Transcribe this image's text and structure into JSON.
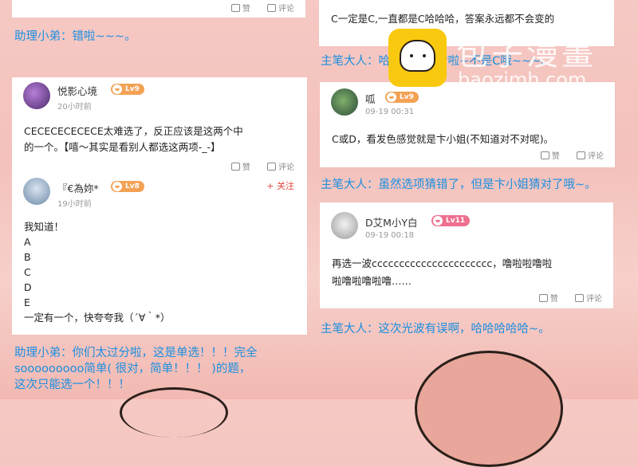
{
  "left": {
    "top_card_actions": {
      "like": "赞",
      "comment": "评论"
    },
    "caption1": "助理小弟：错啦~~~。",
    "comment1": {
      "username": "悦影心境",
      "level": "Lv9",
      "time": "20小时前",
      "text_line1": "CECECECECECE太难选了，反正应该是这两个中",
      "text_line2": "的一个。【嘻～其实是看别人都选这两项-_-】",
      "like": "赞",
      "comment": "评论"
    },
    "comment2": {
      "username": "『€為妳*",
      "level": "Lv8",
      "time": "19小时前",
      "follow": "+ 关注",
      "lines": [
        "我知道！",
        "A",
        "B",
        "C",
        "D",
        "E",
        "一定有一个，快夸夸我（´∀｀*）"
      ]
    },
    "caption2_line1": "助理小弟：你们太过分啦，这是单选！！！完全",
    "caption2_line2": "sooooooooo简单( 很对，简单！！！ )的题，",
    "caption2_line3": "这次只能选一个！！！"
  },
  "right": {
    "top_card_text": "C一定是C,一直都是C哈哈哈，答案永远都不会变的",
    "caption1": "主笔大人：哈哈哈哈哈错啦~不是C哦~~~。",
    "comment1": {
      "username": "呱",
      "level": "Lv9",
      "time": "09-19 00:31",
      "text": "C或D，看发色感觉就是卞小姐(不知道对不对呢)。",
      "like": "赞",
      "comment": "评论"
    },
    "caption2": "主笔大人：虽然选项猜错了，但是卞小姐猜对了哦~。",
    "comment2": {
      "username": "D艾M小Y白",
      "level": "Lv11",
      "time": "09-19 00:18",
      "text_line1": "再选一波cccccccccccccccccccccc，噜啦啦噜啦",
      "text_line2": "啦噜啦噜啦噜……",
      "like": "赞",
      "comment": "评论"
    },
    "caption3": "主笔大人：这次光波有误啊，哈哈哈哈哈~。"
  },
  "watermark": {
    "title": "包子漫畫",
    "url": "baozimh.com"
  },
  "colors": {
    "caption": "#1a8fe0",
    "level_orange": "#f3a154",
    "level_pink": "#ee6f8e",
    "follow": "#e0463a"
  }
}
